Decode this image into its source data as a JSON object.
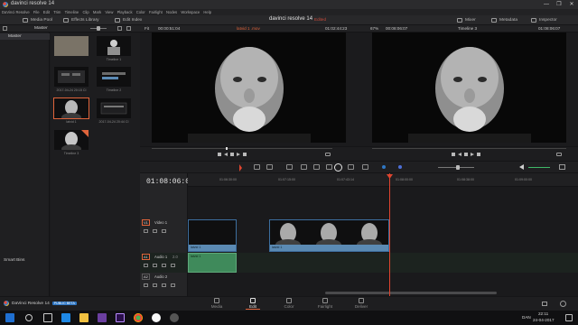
{
  "window": {
    "title": "davinci resolve 14",
    "minimize": "—",
    "maximize": "❐",
    "close": "✕"
  },
  "menu": [
    "DaVinci Resolve",
    "File",
    "Edit",
    "Trim",
    "Timeline",
    "Clip",
    "Mark",
    "View",
    "Playback",
    "Color",
    "Fairlight",
    "Nodes",
    "Workspace",
    "Help"
  ],
  "toolbar": {
    "media_pool": "Media Pool",
    "effects_library": "Effects Library",
    "edit_index": "Edit Index",
    "project_title": "davinci resolve 14",
    "edited": "Edited",
    "mixer": "Mixer",
    "metadata": "Metadata",
    "inspector": "Inspector"
  },
  "media_pool": {
    "bin_label": "Master",
    "master": "Master",
    "smart_bins": "Smart Bins",
    "clips": [
      {
        "name": "",
        "kind": "blank",
        "selected": false
      },
      {
        "name": "Timeline 1",
        "kind": "timeline",
        "selected": false
      },
      {
        "name": "2017-04-24 20:15 CI",
        "kind": "video",
        "selected": false
      },
      {
        "name": "Timeline 2",
        "kind": "timeline",
        "selected": false
      },
      {
        "name": "latvid 1",
        "kind": "video",
        "selected": true
      },
      {
        "name": "2017-04-24 20:44 CI",
        "kind": "video",
        "selected": false
      },
      {
        "name": "Timeline 3",
        "kind": "video",
        "selected": false
      }
    ]
  },
  "viewer": {
    "fit": "Fit",
    "source_tc": "00:00:51:04",
    "source_name": "latvid 1 .mov",
    "source_duration": "01:02:44:23",
    "zoom": "67%",
    "record_tc": "00:08:06:07",
    "timeline_name": "Timeline 3",
    "record_tc_right": "01:08:06:07"
  },
  "timeline": {
    "timecode": "01:08:06:07",
    "ruler": [
      "01:06:30:00",
      "01:07:15:00",
      "01:07:43:14",
      "01:08:00:00",
      "01:08:38:00",
      "01:09:00:00"
    ],
    "tracks": [
      {
        "id": "V1",
        "name": "Video 1",
        "clip_label": "latvid 1"
      },
      {
        "id": "A1",
        "name": "Audio 1",
        "clip_label": "latvid 1"
      },
      {
        "id": "A2",
        "name": "Audio 2",
        "clip_label": ""
      }
    ],
    "clip2_label": "latvid 1",
    "audio_level": "2.0"
  },
  "pages": [
    {
      "label": "Media",
      "active": false
    },
    {
      "label": "Edit",
      "active": true
    },
    {
      "label": "Color",
      "active": false
    },
    {
      "label": "Fairlight",
      "active": false
    },
    {
      "label": "Deliver",
      "active": false
    }
  ],
  "app_badge": {
    "name": "DaVinci Resolve 14",
    "beta": "PUBLIC BETA"
  },
  "taskbar": {
    "lang": "DAN",
    "time": "22:11",
    "date": "24-04-2017"
  },
  "colors": {
    "accent": "#e0643b",
    "playhead": "#e0452f",
    "video_clip": "#5b8ab3",
    "audio_clip": "#3f8a5b",
    "beta": "#2f77c4"
  }
}
